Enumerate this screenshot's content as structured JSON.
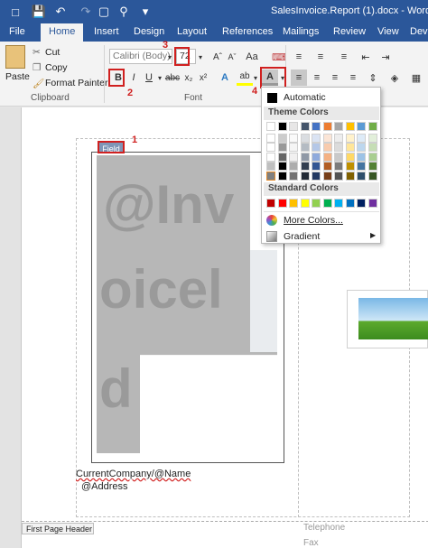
{
  "titlebar": {
    "title": "SalesInvoice.Report (1).docx - Word"
  },
  "tabs": [
    "File",
    "Home",
    "Insert",
    "Design",
    "Layout",
    "References",
    "Mailings",
    "Review",
    "View",
    "Dev"
  ],
  "ribbon": {
    "paste_label": "Paste",
    "cut_label": "Cut",
    "copy_label": "Copy",
    "format_painter_label": "Format Painter",
    "clipboard_group": "Clipboard",
    "font_group": "Font",
    "font_name": "Calibri (Body)",
    "font_size": "72",
    "bold": "B",
    "italic": "I",
    "underline": "U",
    "font_color_glyph": "A"
  },
  "annotations": {
    "n1": "1",
    "n2": "2",
    "n3": "3",
    "n4": "4"
  },
  "color_menu": {
    "automatic": "Automatic",
    "theme_colors": "Theme Colors",
    "standard_colors": "Standard Colors",
    "more_colors": "More Colors...",
    "gradient": "Gradient",
    "theme_top": [
      "#ffffff",
      "#000000",
      "#e7e6e6",
      "#44546a",
      "#4472c4",
      "#ed7d31",
      "#a5a5a5",
      "#ffc000",
      "#5b9bd5",
      "#70ad47"
    ],
    "standard": [
      "#c00000",
      "#ff0000",
      "#ffc000",
      "#ffff00",
      "#92d050",
      "#00b050",
      "#00b0f0",
      "#0070c0",
      "#002060",
      "#7030a0"
    ]
  },
  "document": {
    "field_tag": "Field",
    "big_text_1": "@Inv",
    "big_text_2": "oicel",
    "big_text_3": "d",
    "company_line": "CurrentCompany/@Name",
    "address_line": "@Address",
    "header_tag": "First Page Header",
    "telephone": "Telephone",
    "fax": "Fax"
  }
}
